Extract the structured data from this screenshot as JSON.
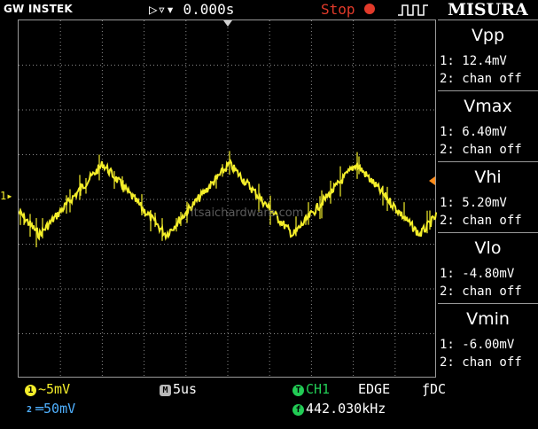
{
  "topbar": {
    "brand": "GW INSTEK",
    "trigger_position": "▷▿▾ 0.000s",
    "run_state": "Stop",
    "menu_title": "MISURA"
  },
  "plot": {
    "ch1_marker": "1▸",
    "watermark": "itsaichardware.com"
  },
  "measurements": [
    {
      "name": "Vpp",
      "ch1": "1: 12.4mV",
      "ch2": "2: chan off"
    },
    {
      "name": "Vmax",
      "ch1": "1: 6.40mV",
      "ch2": "2: chan off"
    },
    {
      "name": "Vhi",
      "ch1": "1: 5.20mV",
      "ch2": "2: chan off"
    },
    {
      "name": "Vlo",
      "ch1": "1: -4.80mV",
      "ch2": "2: chan off"
    },
    {
      "name": "Vmin",
      "ch1": "1: -6.00mV",
      "ch2": "2: chan off"
    }
  ],
  "bottombar": {
    "ch1_badge": "1",
    "ch1_scale": "~5mV",
    "ch2_badge": "2",
    "ch2_scale": "═50mV",
    "timebase_badge": "M",
    "timebase": "5us",
    "trigger_badge": "T",
    "trigger_source": "CH1",
    "trigger_type": "EDGE",
    "trigger_coupling": "ƒDC",
    "freq_badge": "f",
    "frequency": "442.030kHz"
  },
  "colors": {
    "ch1": "#f4ee2a",
    "ch2": "#4fb0ff",
    "stop": "#e23a2a",
    "grid": "#8a8a8a"
  }
}
